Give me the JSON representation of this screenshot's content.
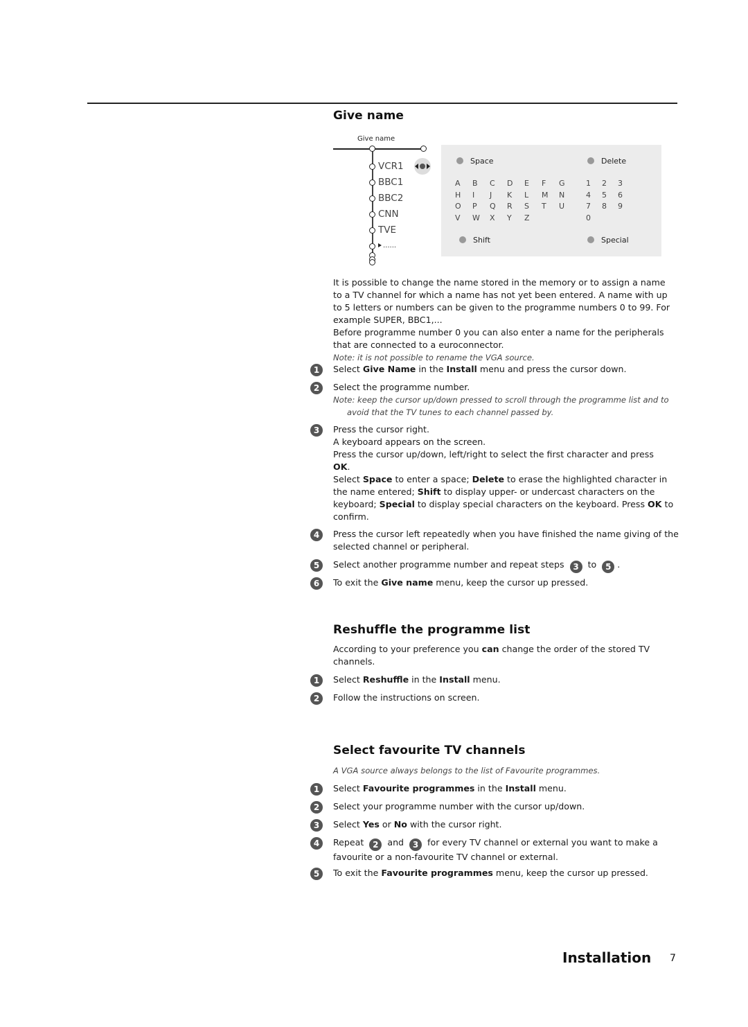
{
  "page": {
    "section_title": "Installation",
    "page_number": "7"
  },
  "give_name": {
    "heading": "Give name",
    "diagram": {
      "title": "Give name",
      "channels": [
        "VCR1",
        "BBC1",
        "BBC2",
        "CNN",
        "TVE"
      ],
      "more": "......",
      "cursor_icon": "cursor-left-right-icon"
    },
    "keyboard": {
      "buttons": {
        "space": "Space",
        "delete": "Delete",
        "shift": "Shift",
        "special": "Special"
      },
      "letters": [
        [
          "A",
          "B",
          "C",
          "D",
          "E",
          "F",
          "G"
        ],
        [
          "H",
          "I",
          "J",
          "K",
          "L",
          "M",
          "N"
        ],
        [
          "O",
          "P",
          "Q",
          "R",
          "S",
          "T",
          "U"
        ],
        [
          "V",
          "W",
          "X",
          "Y",
          "Z"
        ]
      ],
      "digits": [
        [
          "1",
          "2",
          "3"
        ],
        [
          "4",
          "5",
          "6"
        ],
        [
          "7",
          "8",
          "9"
        ],
        [
          "0"
        ]
      ]
    },
    "intro_lines": [
      "It is possible to change the name stored in the memory or to assign a name",
      "to a TV channel for which a name has not yet been entered. A name with up",
      "to 5 letters or numbers can be given to the programme numbers 0 to 99. For",
      "example SUPER, BBC1,...",
      "Before programme number 0 you can also enter a name for the peripherals",
      "that are connected to a euroconnector."
    ],
    "note": "Note: it is not possible to rename the VGA source.",
    "steps": {
      "s1": {
        "num": "1",
        "pre": "Select ",
        "b1": "Give Name",
        "mid": " in the ",
        "b2": "Install",
        "post": " menu and press the cursor down."
      },
      "s2": {
        "num": "2",
        "text": "Select the programme number.",
        "note1": "Note: keep the cursor up/down pressed to scroll through the programme list and to",
        "note2": "avoid that the TV tunes to each channel passed by."
      },
      "s3": {
        "num": "3",
        "l1": "Press the cursor right.",
        "l2": "A keyboard appears on the screen.",
        "l3": "Press the cursor up/down, left/right to select the first character and press",
        "l4_b": "OK",
        "l4_post": ".",
        "l5_pre": "Select ",
        "l5_b1": "Space",
        "l5_m1": " to enter a space; ",
        "l5_b2": "Delete",
        "l5_post": " to erase the highlighted character in",
        "l6_pre": "the name entered; ",
        "l6_b": "Shift",
        "l6_post": " to display upper- or undercast characters on the",
        "l7_pre": "keyboard; ",
        "l7_b1": "Special",
        "l7_m": " to display special characters on the keyboard. Press ",
        "l7_b2": "OK",
        "l7_post": " to",
        "l8": "confirm."
      },
      "s4": {
        "num": "4",
        "l1": "Press the cursor left repeatedly when you have finished the name giving of the",
        "l2": "selected channel or peripheral."
      },
      "s5": {
        "num": "5",
        "pre": "Select another programme number and repeat steps ",
        "ref1": "3",
        "mid": " to ",
        "ref2": "5",
        "post": "."
      },
      "s6": {
        "num": "6",
        "pre": "To exit the ",
        "b": "Give name",
        "post": " menu, keep the cursor up pressed."
      }
    }
  },
  "reshuffle": {
    "heading": "Reshuffle the programme list",
    "intro_pre": "According to your preference you ",
    "intro_b": "can",
    "intro_post": " change the order of the stored TV",
    "intro_l2": "channels.",
    "steps": {
      "s1": {
        "num": "1",
        "pre": "Select ",
        "b1": "Reshuffle",
        "mid": " in the ",
        "b2": "Install",
        "post": " menu."
      },
      "s2": {
        "num": "2",
        "text": "Follow the instructions on screen."
      }
    }
  },
  "favourites": {
    "heading": "Select favourite TV channels",
    "note": "A VGA source always belongs to the list of Favourite programmes.",
    "steps": {
      "s1": {
        "num": "1",
        "pre": "Select ",
        "b1": "Favourite programmes",
        "mid": " in the ",
        "b2": "Install",
        "post": " menu."
      },
      "s2": {
        "num": "2",
        "text": "Select your programme number with the cursor up/down."
      },
      "s3": {
        "num": "3",
        "pre": "Select ",
        "b1": "Yes",
        "mid": " or ",
        "b2": "No",
        "post": " with the cursor right."
      },
      "s4": {
        "num": "4",
        "pre": "Repeat ",
        "ref1": "2",
        "mid": " and ",
        "ref2": "3",
        "post": " for every TV channel or external you want to make a",
        "l2": "favourite or a non-favourite TV channel or external."
      },
      "s5": {
        "num": "5",
        "pre": "To exit the ",
        "b": "Favourite programmes",
        "post": " menu, keep the cursor up pressed."
      }
    }
  }
}
